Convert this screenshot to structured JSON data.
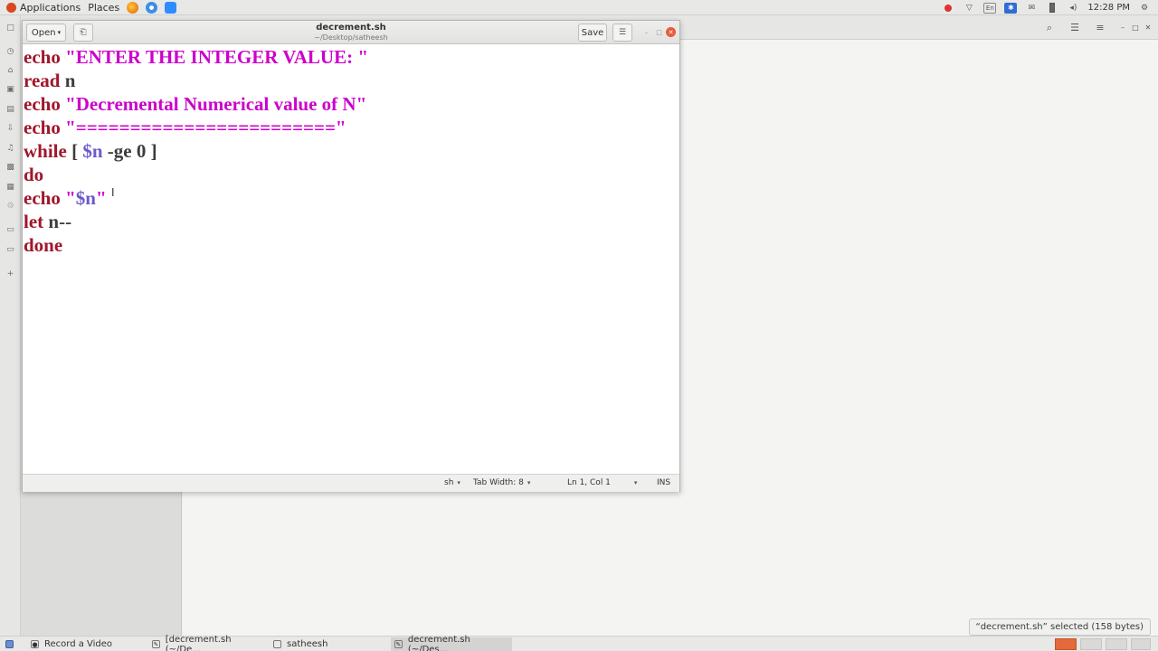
{
  "top_panel": {
    "applications": "Applications",
    "places": "Places",
    "lang": "En",
    "clock": "12:28 PM"
  },
  "gedit": {
    "open_label": "Open",
    "title": "decrement.sh",
    "subtitle": "~/Desktop/satheesh",
    "save_label": "Save",
    "code": [
      {
        "t1": "echo",
        "t2": " \"ENTER THE INTEGER VALUE: \""
      },
      {
        "t1": "read",
        "t2": " n"
      },
      {
        "t1": "echo",
        "t2": " \"Decremental Numerical value of N\""
      },
      {
        "t1": "echo",
        "t2": " \"========================\""
      },
      {
        "t1": "while",
        "t2": " [ ",
        "t3": "$n",
        "t4": " -ge 0 ]"
      },
      {
        "t1": "do"
      },
      {
        "t1": "echo",
        "t2": " \"",
        "t3": "$n",
        "t4": "\""
      },
      {
        "t1": "let",
        "t2": " n--"
      },
      {
        "t1": "done"
      }
    ],
    "status": {
      "language": "sh",
      "tab_width": "Tab Width: 8",
      "position": "Ln 1, Col 1",
      "mode": "INS"
    }
  },
  "file_manager": {
    "status_text": "“decrement.sh” selected  (158 bytes)"
  },
  "taskbar": {
    "tasks": [
      {
        "label": "Record a Video"
      },
      {
        "label": "[decrement.sh (~/De..."
      },
      {
        "label": "satheesh"
      },
      {
        "label": "decrement.sh (~/Des..."
      }
    ]
  },
  "colors": {
    "keyword": "#a0162b",
    "string": "#cc00cc",
    "variable": "#6a5acd",
    "close_button": "#e85a3a"
  }
}
